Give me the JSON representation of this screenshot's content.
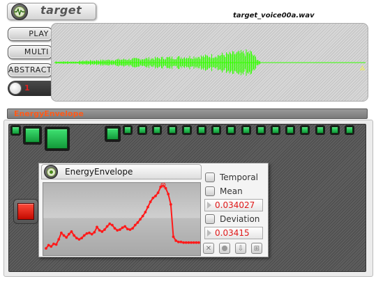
{
  "app": {
    "title": "target"
  },
  "header": {
    "filename": "target_voice00a.wav"
  },
  "sidebar": {
    "buttons": [
      {
        "label": "Play"
      },
      {
        "label": "Multi"
      },
      {
        "label": "Abstract"
      }
    ],
    "record_number": "1"
  },
  "section": {
    "title": "EnergyEnvelope"
  },
  "module": {
    "title": "EnergyEnvelope",
    "options": [
      {
        "label": "Temporal",
        "checked": false
      },
      {
        "label": "Mean",
        "checked": false,
        "value": "0.034027"
      },
      {
        "label": "Deviation",
        "checked": false,
        "value": "0.03415"
      }
    ],
    "tools": [
      {
        "icon": "close-icon"
      },
      {
        "icon": "record-icon"
      },
      {
        "icon": "download-icon"
      },
      {
        "icon": "expand-icon"
      }
    ]
  },
  "pads": {
    "small_row_count": 16,
    "accent_color": "#1fb84a",
    "alert_color": "#e81a0a"
  },
  "colors": {
    "waveform": "#33ff00",
    "envelope": "#ff1a1a",
    "section_title": "#ff5a1a",
    "marker": "#ffff00"
  },
  "chart_data": {
    "type": "line",
    "series": [
      {
        "values": [
          0.02,
          0.07,
          0.05,
          0.09,
          0.08,
          0.16,
          0.26,
          0.22,
          0.19,
          0.24,
          0.28,
          0.22,
          0.18,
          0.16,
          0.18,
          0.22,
          0.25,
          0.26,
          0.24,
          0.27,
          0.35,
          0.3,
          0.28,
          0.31,
          0.36,
          0.4,
          0.38,
          0.33,
          0.3,
          0.31,
          0.34,
          0.36,
          0.32,
          0.31,
          0.33,
          0.38,
          0.42,
          0.47,
          0.52,
          0.58,
          0.66,
          0.74,
          0.8,
          0.83,
          0.88,
          0.97,
          1.0,
          0.95,
          0.86,
          0.7,
          0.2,
          0.14,
          0.12,
          0.12,
          0.11,
          0.11,
          0.11,
          0.11,
          0.11,
          0.11,
          0.11
        ]
      }
    ],
    "title": "",
    "xlabel": "",
    "ylabel": ""
  }
}
